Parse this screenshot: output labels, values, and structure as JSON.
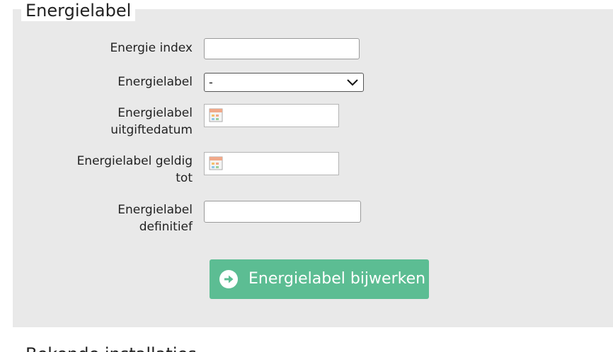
{
  "section": {
    "title": "Energielabel"
  },
  "fields": {
    "energie_index": {
      "label": "Energie index",
      "value": ""
    },
    "energielabel": {
      "label": "Energielabel",
      "selected": "-"
    },
    "uitgiftedatum": {
      "label_line1": "Energielabel",
      "label_line2": "uitgiftedatum",
      "value": ""
    },
    "geldig_tot": {
      "label_line1": "Energielabel geldig",
      "label_line2": "tot",
      "value": ""
    },
    "definitief": {
      "label_line1": "Energielabel",
      "label_line2": "definitief",
      "value": ""
    }
  },
  "actions": {
    "update_label": "Energielabel bijwerken"
  },
  "next_section": {
    "title": "Bekende installaties"
  },
  "colors": {
    "panel_bg": "#e9e9e9",
    "button_bg": "#5cbd93",
    "button_text": "#ffffff"
  }
}
